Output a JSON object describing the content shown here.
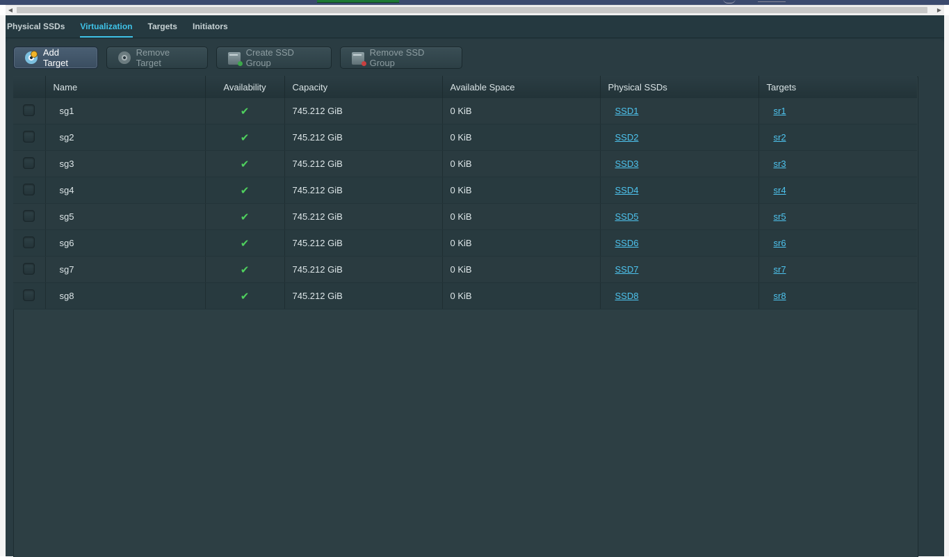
{
  "tabs": [
    {
      "label": "Physical SSDs"
    },
    {
      "label": "Virtualization"
    },
    {
      "label": "Targets"
    },
    {
      "label": "Initiators"
    }
  ],
  "active_tab": "Virtualization",
  "toolbar": {
    "add_target": "Add Target",
    "remove_target": "Remove Target",
    "create_ssd_group": "Create SSD Group",
    "remove_ssd_group": "Remove SSD Group"
  },
  "table": {
    "headers": {
      "name": "Name",
      "availability": "Availability",
      "capacity": "Capacity",
      "available_space": "Available Space",
      "physical_ssds": "Physical SSDs",
      "targets": "Targets"
    },
    "rows": [
      {
        "name": "sg1",
        "available": true,
        "capacity": "745.212 GiB",
        "available_space": "0 KiB",
        "physical_ssd": "SSD1",
        "target": "sr1"
      },
      {
        "name": "sg2",
        "available": true,
        "capacity": "745.212 GiB",
        "available_space": "0 KiB",
        "physical_ssd": "SSD2",
        "target": "sr2"
      },
      {
        "name": "sg3",
        "available": true,
        "capacity": "745.212 GiB",
        "available_space": "0 KiB",
        "physical_ssd": "SSD3",
        "target": "sr3"
      },
      {
        "name": "sg4",
        "available": true,
        "capacity": "745.212 GiB",
        "available_space": "0 KiB",
        "physical_ssd": "SSD4",
        "target": "sr4"
      },
      {
        "name": "sg5",
        "available": true,
        "capacity": "745.212 GiB",
        "available_space": "0 KiB",
        "physical_ssd": "SSD5",
        "target": "sr5"
      },
      {
        "name": "sg6",
        "available": true,
        "capacity": "745.212 GiB",
        "available_space": "0 KiB",
        "physical_ssd": "SSD6",
        "target": "sr6"
      },
      {
        "name": "sg7",
        "available": true,
        "capacity": "745.212 GiB",
        "available_space": "0 KiB",
        "physical_ssd": "SSD7",
        "target": "sr7"
      },
      {
        "name": "sg8",
        "available": true,
        "capacity": "745.212 GiB",
        "available_space": "0 KiB",
        "physical_ssd": "SSD8",
        "target": "sr8"
      }
    ]
  },
  "colors": {
    "accent": "#3fc3e8",
    "background": "#253940",
    "check": "#4fd15e",
    "link": "#4ec4ef"
  },
  "icons": {
    "available": "check-icon",
    "add_target": "disc-add-icon",
    "remove_target": "disc-icon",
    "create_ssd_group": "drive-add-icon",
    "remove_ssd_group": "drive-remove-icon"
  }
}
